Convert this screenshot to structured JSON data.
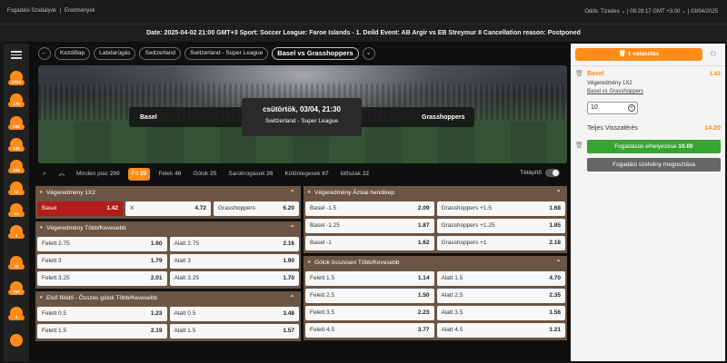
{
  "topbar": {
    "link1": "Fogadási Szabályok",
    "separator": "|",
    "link2": "Eredmények",
    "right": "Odds: Tizedes ⌄ | 08:28:17 GMT +3:00 ⌄ | 03/04/2025"
  },
  "notice": "Date: 2025-04-02 21:00 GMT+3 Sport: Soccer League: Faroe Islands - 1. Deild Event: AB Argir vs EB Streymur II Cancellation reason: Postponed",
  "sidebar": {
    "counts": [
      "2010",
      "175",
      "290",
      "136",
      "609",
      "10",
      "61",
      "1",
      "25",
      "358",
      "4"
    ]
  },
  "breadcrumbs": {
    "items": [
      "Kezdőlap",
      "Labdarúgás",
      "Switzerland",
      "Switzerland - Super League"
    ],
    "active": "Basel vs Grasshoppers"
  },
  "match": {
    "home": "Basel",
    "away": "Grasshoppers",
    "datetime": "csütörtök, 03/04, 21:30",
    "league": "Switzerland - Super League"
  },
  "tabs": [
    {
      "label": "Minden piac",
      "count": "200"
    },
    {
      "label": "Fő",
      "count": "29"
    },
    {
      "label": "Felek",
      "count": "46"
    },
    {
      "label": "Gólok",
      "count": "25"
    },
    {
      "label": "Sarokrúgások",
      "count": "26"
    },
    {
      "label": "Különlegesek",
      "count": "67"
    },
    {
      "label": "Időszak",
      "count": "22"
    }
  ],
  "tetepito": "Tétépítő",
  "left_markets": [
    {
      "title": "Végeredmény 1X2",
      "rows": [
        [
          {
            "label": "Basel",
            "price": "1.42"
          },
          {
            "label": "X",
            "price": "4.72"
          },
          {
            "label": "Grasshoppers",
            "price": "6.20"
          }
        ]
      ]
    },
    {
      "title": "Végeredmény Több/Kevesebb",
      "rows": [
        [
          {
            "label": "Felett 2.75",
            "price": "1.60"
          },
          {
            "label": "Alatt 2.75",
            "price": "2.16"
          }
        ],
        [
          {
            "label": "Felett 3",
            "price": "1.79"
          },
          {
            "label": "Alatt 3",
            "price": "1.90"
          }
        ],
        [
          {
            "label": "Felett 3.25",
            "price": "2.01"
          },
          {
            "label": "Alatt 3.25",
            "price": "1.70"
          }
        ]
      ]
    },
    {
      "title": "Első félidő - Összes gólok Több/Kevesebb",
      "rows": [
        [
          {
            "label": "Felett 0.5",
            "price": "1.23"
          },
          {
            "label": "Alatt 0.5",
            "price": "3.48"
          }
        ],
        [
          {
            "label": "Felett 1.5",
            "price": "2.19"
          },
          {
            "label": "Alatt 1.5",
            "price": "1.57"
          }
        ]
      ]
    }
  ],
  "right_markets": [
    {
      "title": "Végeredmény Ázsiai hendikep",
      "rows": [
        [
          {
            "label": "Basel -1.5",
            "price": "2.09"
          },
          {
            "label": "Grasshoppers +1.5",
            "price": "1.68"
          }
        ],
        [
          {
            "label": "Basel -1.25",
            "price": "1.87"
          },
          {
            "label": "Grasshoppers +1.25",
            "price": "1.85"
          }
        ],
        [
          {
            "label": "Basel -1",
            "price": "1.62"
          },
          {
            "label": "Grasshoppers +1",
            "price": "2.18"
          }
        ]
      ]
    },
    {
      "title": "Gólok összesen Több/Kevesebb",
      "rows": [
        [
          {
            "label": "Felett 1.5",
            "price": "1.14"
          },
          {
            "label": "Alatt 1.5",
            "price": "4.70"
          }
        ],
        [
          {
            "label": "Felett 2.5",
            "price": "1.50"
          },
          {
            "label": "Alatt 2.5",
            "price": "2.35"
          }
        ],
        [
          {
            "label": "Felett 3.5",
            "price": "2.23"
          },
          {
            "label": "Alatt 3.5",
            "price": "1.56"
          }
        ],
        [
          {
            "label": "Felett 4.5",
            "price": "3.77"
          },
          {
            "label": "Alatt 4.5",
            "price": "1.21"
          }
        ]
      ]
    }
  ],
  "slip": {
    "header": "1 választás",
    "team": "Basel",
    "odds": "1.42",
    "market": "Végeredmény 1X2",
    "match": "Basel vs Grasshoppers",
    "stake": "10",
    "total_label": "Teljes Visszatérés",
    "total_value": "14.20",
    "place_label": "Fogadások elhelyezése",
    "place_amount": "10.00",
    "share_label": "Fogadási szelvény megosztása"
  },
  "colors": {
    "accent": "#ff8c1a",
    "market_header": "#6b5545",
    "selected": "#b31c1c",
    "place_button": "#3aa335"
  }
}
